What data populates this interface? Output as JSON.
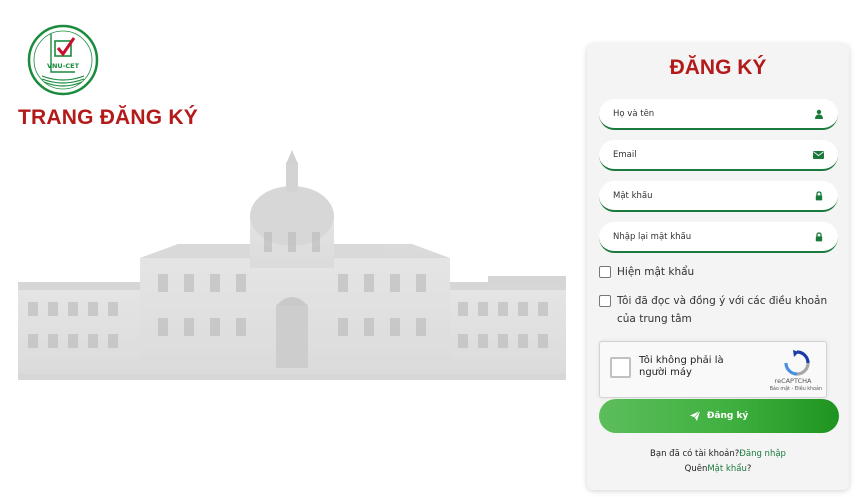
{
  "brand": {
    "logo_text": "VNU-CET"
  },
  "page": {
    "heading": "TRANG ĐĂNG KÝ"
  },
  "form": {
    "title": "ĐĂNG KÝ",
    "fields": {
      "fullname": {
        "placeholder": "Họ và tên",
        "icon": "user-icon"
      },
      "email": {
        "placeholder": "Email",
        "icon": "envelope-icon"
      },
      "password": {
        "placeholder": "Mật khẩu",
        "icon": "lock-icon"
      },
      "confirm": {
        "placeholder": "Nhập lại mật khẩu",
        "icon": "lock-icon"
      }
    },
    "show_password_label": "Hiện mật khẩu",
    "terms_label": "Tôi đã đọc và đồng ý với các điều khoản của trung tâm",
    "captcha": {
      "label": "Tôi không phải là người máy",
      "brand": "reCAPTCHA",
      "links": "Bảo mật - Điều khoản"
    },
    "submit_label": "Đăng ký",
    "have_account_text": "Bạn đã có tài khoản?",
    "login_link": "Đăng nhập",
    "forgot_prefix": "Quên",
    "forgot_link": "Mật khẩu",
    "forgot_suffix": "?"
  },
  "colors": {
    "accent_red": "#b31b1b",
    "accent_green": "#1a7a3c",
    "button_green": "#3fb03f"
  }
}
